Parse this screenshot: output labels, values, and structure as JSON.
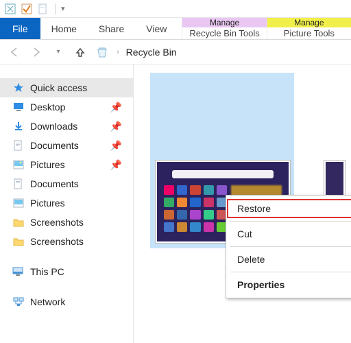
{
  "qat": {
    "app_icon": "recycle-bin",
    "check_icon": "orange-check",
    "dropdown_hint": "▾"
  },
  "ribbon": {
    "file": "File",
    "tabs": [
      "Home",
      "Share",
      "View"
    ],
    "context": [
      {
        "label": "Manage",
        "sub": "Recycle Bin Tools"
      },
      {
        "label": "Manage",
        "sub": "Picture Tools"
      }
    ]
  },
  "address": {
    "location": "Recycle Bin"
  },
  "sidebar": {
    "quick_access": "Quick access",
    "items": [
      {
        "label": "Desktop",
        "pinned": true
      },
      {
        "label": "Downloads",
        "pinned": true
      },
      {
        "label": "Documents",
        "pinned": true
      },
      {
        "label": "Pictures",
        "pinned": true
      },
      {
        "label": "Documents",
        "pinned": false
      },
      {
        "label": "Pictures",
        "pinned": false
      },
      {
        "label": "Screenshots",
        "pinned": false
      },
      {
        "label": "Screenshots",
        "pinned": false
      }
    ],
    "this_pc": "This PC",
    "network": "Network"
  },
  "context_menu": {
    "restore": "Restore",
    "cut": "Cut",
    "delete": "Delete",
    "properties": "Properties"
  }
}
